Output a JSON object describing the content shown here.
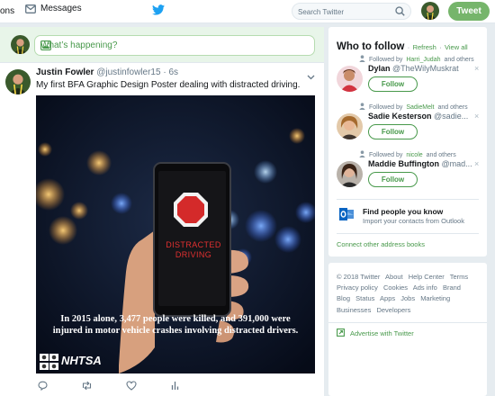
{
  "nav": {
    "left_fragment": "ons",
    "messages_label": "Messages",
    "search_placeholder": "Search Twitter",
    "tweet_button": "Tweet"
  },
  "compose": {
    "placeholder": "What’s happening?"
  },
  "tweet": {
    "author_name": "Justin Fowler",
    "author_handle": "@justinfowler15",
    "separator": "·",
    "time": "6s",
    "text": "My first BFA Graphic Design Poster dealing with distracted driving.",
    "poster": {
      "sign_line1": "DISTRACTED",
      "sign_line2": "DRIVING",
      "caption": "In 2015 alone, 3,477 people were killed, and 391,000 were injured in motor vehicle crashes involving distracted drivers.",
      "logo": "NHTSA"
    }
  },
  "who_to_follow": {
    "title": "Who to follow",
    "separator": "·",
    "refresh_label": "Refresh",
    "view_all_label": "View all",
    "suggestions": [
      {
        "context_prefix": "Followed by",
        "context_name": "Harri_Judah",
        "context_suffix": "and others",
        "name": "Dylan",
        "handle": "@TheWilyMuskrat",
        "follow_label": "Follow"
      },
      {
        "context_prefix": "Followed by",
        "context_name": "SadieMelt",
        "context_suffix": "and others",
        "name": "Sadie Kesterson",
        "handle": "@sadie...",
        "follow_label": "Follow"
      },
      {
        "context_prefix": "Followed by",
        "context_name": "nicole",
        "context_suffix": "and others",
        "name": "Maddie Buffington",
        "handle": "@mad...",
        "follow_label": "Follow"
      }
    ],
    "dismiss_glyph": "×",
    "find_people_title": "Find people you know",
    "find_people_sub": "Import your contacts from Outlook",
    "connect_label": "Connect other address books"
  },
  "footer": {
    "links": [
      "© 2018 Twitter",
      "About",
      "Help Center",
      "Terms",
      "Privacy policy",
      "Cookies",
      "Ads info",
      "Brand",
      "Blog",
      "Status",
      "Apps",
      "Jobs",
      "Marketing",
      "Businesses",
      "Developers"
    ],
    "advertise_label": "Advertise with Twitter"
  },
  "colors": {
    "accent_green": "#76b56b",
    "link_green": "#48994b",
    "twitter_blue": "#1da1f2"
  }
}
